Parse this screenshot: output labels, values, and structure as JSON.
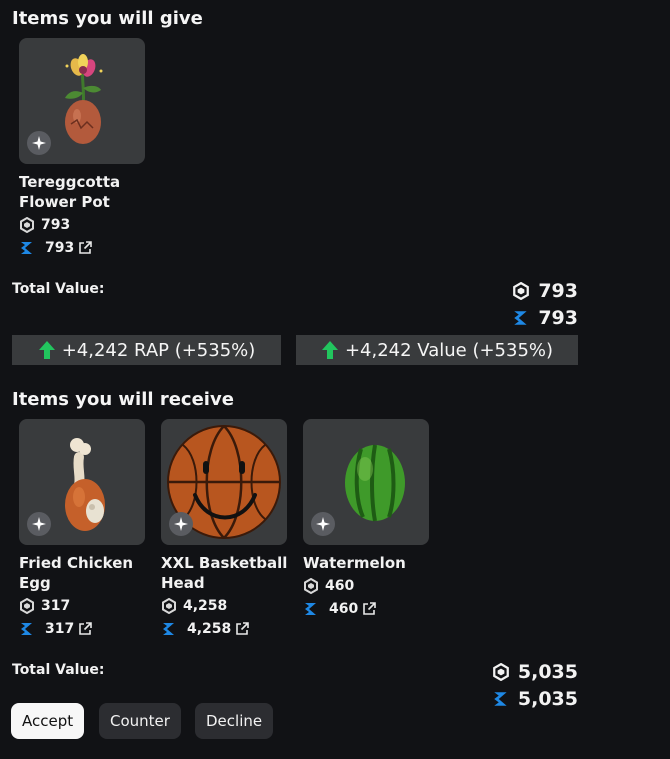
{
  "give": {
    "title": "Items you will give",
    "items": [
      {
        "name": "Tereggcotta Flower Pot",
        "rap": "793",
        "value": "793"
      }
    ],
    "total_label": "Total Value:",
    "total_rap": "793",
    "total_value": "793"
  },
  "diff": {
    "rap_text": "+4,242 RAP (+535%)",
    "value_text": "+4,242 Value (+535%)"
  },
  "receive": {
    "title": "Items you will receive",
    "items": [
      {
        "name": "Fried Chicken Egg",
        "rap": "317",
        "value": "317"
      },
      {
        "name": "XXL Basketball Head",
        "rap": "4,258",
        "value": "4,258"
      },
      {
        "name": "Watermelon",
        "rap": "460",
        "value": "460"
      }
    ],
    "total_label": "Total Value:",
    "total_rap": "5,035",
    "total_value": "5,035"
  },
  "actions": {
    "accept": "Accept",
    "counter": "Counter",
    "decline": "Decline"
  },
  "icons": {
    "rap": "robux-hexagon-icon",
    "value": "rolimons-value-icon",
    "link": "external-link-icon",
    "badge": "sparkle-icon",
    "arrow": "up-arrow-icon"
  },
  "colors": {
    "background": "#111215",
    "card": "#393b3d",
    "value_icon": "#1e88e5",
    "arrow": "#22c55e"
  }
}
